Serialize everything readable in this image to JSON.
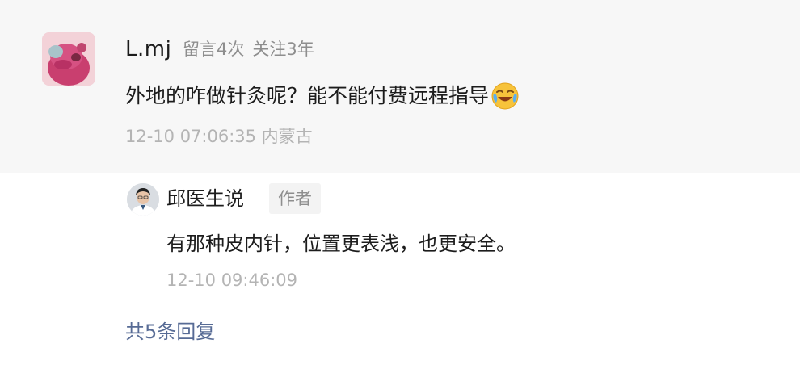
{
  "comment": {
    "username": "L.mj",
    "comment_count_label": "留言4次",
    "follow_label": "关注3年",
    "text": "外地的咋做针灸呢？能不能付费远程指导",
    "emoji": "face-with-tears-of-joy-emoji",
    "time_location": "12-10 07:06:35 内蒙古"
  },
  "reply": {
    "author_name": "邱医生说",
    "badge": "作者",
    "text": "有那种皮内针，位置更表浅，也更安全。",
    "time": "12-10 09:46:09"
  },
  "more_replies_label": "共5条回复",
  "colors": {
    "comment_bg": "#f7f7f7",
    "link": "#576b95",
    "meta": "#8e8e8e",
    "time": "#b4b4b4"
  }
}
